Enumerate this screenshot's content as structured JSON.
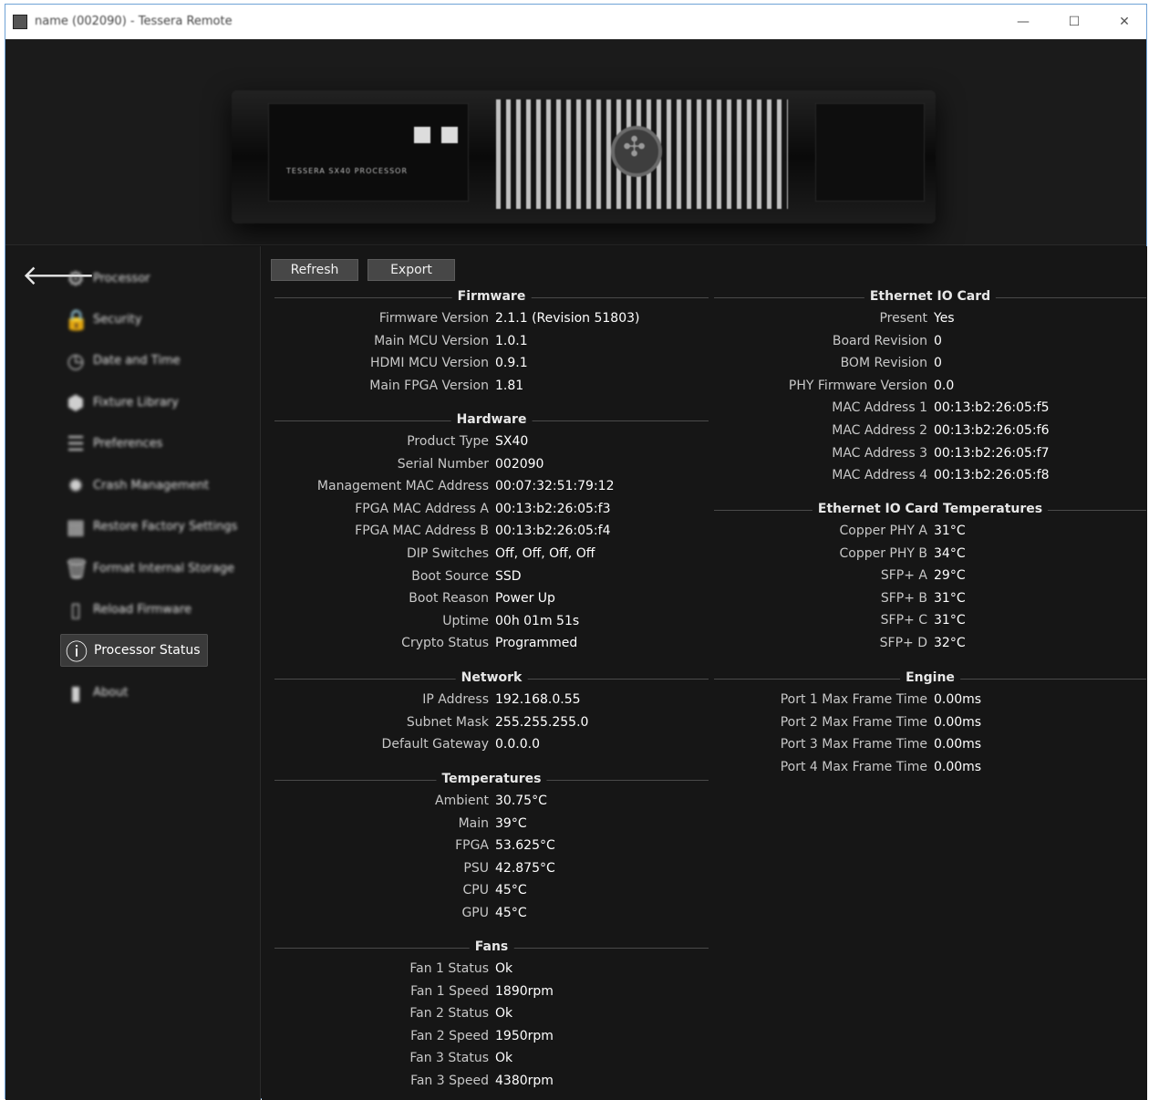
{
  "window": {
    "title": "name (002090) - Tessera Remote",
    "minimize_glyph": "—",
    "maximize_glyph": "☐",
    "close_glyph": "✕"
  },
  "device": {
    "model_text": "TESSERA SX40 PROCESSOR"
  },
  "sidebar": {
    "back_icon": "back-arrow-icon",
    "items": [
      {
        "label": "Processor",
        "icon": "gear-icon",
        "glyph": "⚙"
      },
      {
        "label": "Security",
        "icon": "lock-icon",
        "glyph": "🔒"
      },
      {
        "label": "Date and Time",
        "icon": "clock-icon",
        "glyph": "◷"
      },
      {
        "label": "Fixture Library",
        "icon": "cube-icon",
        "glyph": "⬢"
      },
      {
        "label": "Preferences",
        "icon": "list-icon",
        "glyph": "☰"
      },
      {
        "label": "Crash Management",
        "icon": "crash-icon",
        "glyph": "✹"
      },
      {
        "label": "Restore Factory Settings",
        "icon": "factory-icon",
        "glyph": "▦"
      },
      {
        "label": "Format Internal Storage",
        "icon": "trash-icon",
        "glyph": "🗑"
      },
      {
        "label": "Reload Firmware",
        "icon": "firmware-icon",
        "glyph": "▯"
      },
      {
        "label": "Processor Status",
        "icon": "info-icon",
        "glyph": "ⓘ"
      },
      {
        "label": "About",
        "icon": "book-icon",
        "glyph": "▮"
      }
    ]
  },
  "toolbar": {
    "refresh_label": "Refresh",
    "export_label": "Export"
  },
  "left_sections": [
    {
      "title": "Firmware",
      "rows": [
        [
          "Firmware Version",
          "2.1.1 (Revision 51803)"
        ],
        [
          "Main MCU Version",
          "1.0.1"
        ],
        [
          "HDMI MCU Version",
          "0.9.1"
        ],
        [
          "Main FPGA Version",
          "1.81"
        ]
      ]
    },
    {
      "title": "Hardware",
      "rows": [
        [
          "Product Type",
          "SX40"
        ],
        [
          "Serial Number",
          "002090"
        ],
        [
          "Management MAC Address",
          "00:07:32:51:79:12"
        ],
        [
          "FPGA MAC Address A",
          "00:13:b2:26:05:f3"
        ],
        [
          "FPGA MAC Address B",
          "00:13:b2:26:05:f4"
        ],
        [
          "DIP Switches",
          "Off, Off, Off, Off"
        ],
        [
          "Boot Source",
          "SSD"
        ],
        [
          "Boot Reason",
          "Power Up"
        ],
        [
          "Uptime",
          "00h 01m 51s"
        ],
        [
          "Crypto Status",
          "Programmed"
        ]
      ]
    },
    {
      "title": "Network",
      "rows": [
        [
          "IP Address",
          "192.168.0.55"
        ],
        [
          "Subnet Mask",
          "255.255.255.0"
        ],
        [
          "Default Gateway",
          "0.0.0.0"
        ]
      ]
    },
    {
      "title": "Temperatures",
      "rows": [
        [
          "Ambient",
          "30.75°C"
        ],
        [
          "Main",
          "39°C"
        ],
        [
          "FPGA",
          "53.625°C"
        ],
        [
          "PSU",
          "42.875°C"
        ],
        [
          "CPU",
          "45°C"
        ],
        [
          "GPU",
          "45°C"
        ]
      ]
    },
    {
      "title": "Fans",
      "rows": [
        [
          "Fan 1 Status",
          "Ok"
        ],
        [
          "Fan 1 Speed",
          "1890rpm"
        ],
        [
          "Fan 2 Status",
          "Ok"
        ],
        [
          "Fan 2 Speed",
          "1950rpm"
        ],
        [
          "Fan 3 Status",
          "Ok"
        ],
        [
          "Fan 3 Speed",
          "4380rpm"
        ]
      ]
    }
  ],
  "right_sections": [
    {
      "title": "Ethernet IO Card",
      "rows": [
        [
          "Present",
          "Yes"
        ],
        [
          "Board Revision",
          "0"
        ],
        [
          "BOM Revision",
          "0"
        ],
        [
          "PHY Firmware Version",
          "0.0"
        ],
        [
          "MAC Address 1",
          "00:13:b2:26:05:f5"
        ],
        [
          "MAC Address 2",
          "00:13:b2:26:05:f6"
        ],
        [
          "MAC Address 3",
          "00:13:b2:26:05:f7"
        ],
        [
          "MAC Address 4",
          "00:13:b2:26:05:f8"
        ]
      ]
    },
    {
      "title": "Ethernet IO Card Temperatures",
      "rows": [
        [
          "Copper PHY A",
          "31°C"
        ],
        [
          "Copper PHY B",
          "34°C"
        ],
        [
          "SFP+ A",
          "29°C"
        ],
        [
          "SFP+ B",
          "31°C"
        ],
        [
          "SFP+ C",
          "31°C"
        ],
        [
          "SFP+ D",
          "32°C"
        ]
      ]
    },
    {
      "title": "Engine",
      "rows": [
        [
          "Port 1 Max Frame Time",
          "0.00ms"
        ],
        [
          "Port 2 Max Frame Time",
          "0.00ms"
        ],
        [
          "Port 3 Max Frame Time",
          "0.00ms"
        ],
        [
          "Port 4 Max Frame Time",
          "0.00ms"
        ]
      ]
    }
  ]
}
